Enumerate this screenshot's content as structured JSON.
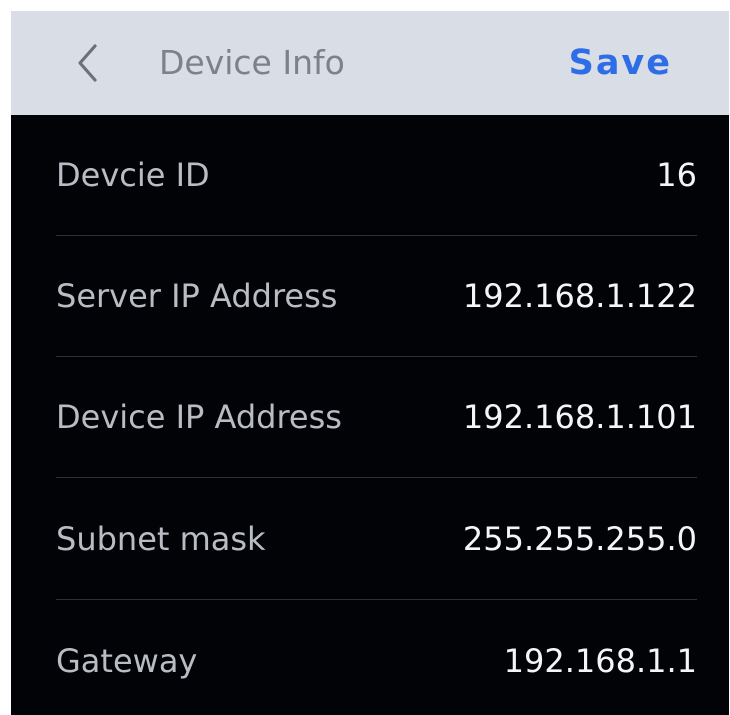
{
  "header": {
    "back_icon": "chevron-left-icon",
    "title": "Device Info",
    "save_label": "Save"
  },
  "colors": {
    "header_bg": "#d8dde6",
    "content_bg": "#020307",
    "accent": "#2f6de6",
    "label_text": "#b9bcc3",
    "value_text": "#f4f5f7"
  },
  "fields": [
    {
      "label": "Devcie ID",
      "value": "16"
    },
    {
      "label": "Server IP Address",
      "value": "192.168.1.122"
    },
    {
      "label": "Device IP Address",
      "value": "192.168.1.101"
    },
    {
      "label": "Subnet mask",
      "value": "255.255.255.0"
    },
    {
      "label": "Gateway",
      "value": "192.168.1.1"
    }
  ]
}
